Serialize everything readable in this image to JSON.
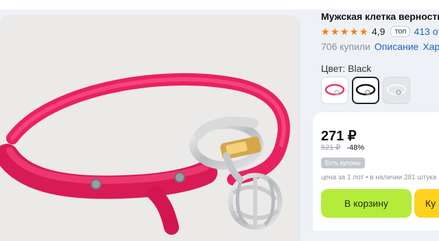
{
  "product": {
    "title": "Мужская клетка верности",
    "rating": {
      "stars": 5,
      "value": "4,9",
      "badge": "топ",
      "reviews": "413 от"
    },
    "bought": "706 купили",
    "links": [
      "Описание",
      "Хара"
    ],
    "color_label": "Цвет: Black",
    "swatches": [
      {
        "name": "pink",
        "selected": false
      },
      {
        "name": "black",
        "selected": true
      },
      {
        "name": "clear",
        "selected": false
      }
    ]
  },
  "pricing": {
    "price": "271 ₽",
    "old_price": "521 ₽",
    "discount": "-48%",
    "coupon_badge": "Есть купоны",
    "stock_info": "цена за 1 лот • в наличии 281 штука",
    "add_to_cart": "В корзину",
    "buy_now": "Ку"
  },
  "colors": {
    "accent_link": "#1e61c8",
    "star": "#ff7a00",
    "cart_button": "#b5ec3b",
    "buy_button": "#ffd21f",
    "strap_pink": "#f0306a"
  },
  "icons": [
    "star-icon"
  ]
}
